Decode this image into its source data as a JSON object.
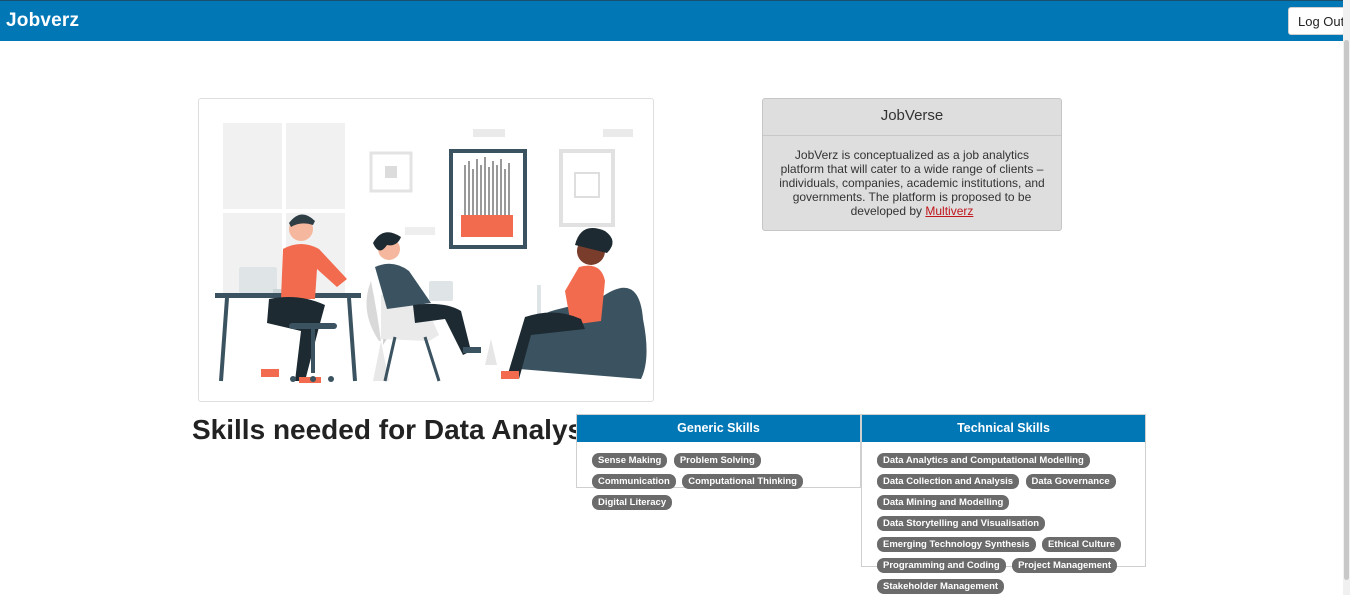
{
  "navbar": {
    "brand": "Jobverz",
    "logout_label": "Log Out"
  },
  "info_card": {
    "title": "JobVerse",
    "body": "JobVerz is conceptualized as a job analytics platform that will cater to a wide range of clients – individuals, companies, academic institutions, and governments. The platform is proposed to be developed by",
    "link_text": "Multiverz"
  },
  "heading": "Skills needed for Data Analyst",
  "generic_skills": {
    "title": "Generic Skills",
    "skills": [
      "Sense Making",
      "Problem Solving",
      "Communication",
      "Computational Thinking",
      "Digital Literacy"
    ]
  },
  "technical_skills": {
    "title": "Technical Skills",
    "skills": [
      "Data Analytics and Computational Modelling",
      "Data Collection and Analysis",
      "Data Governance",
      "Data Mining and Modelling",
      "Data Storytelling and Visualisation",
      "Emerging Technology Synthesis",
      "Ethical Culture",
      "Programming and Coding",
      "Project Management",
      "Stakeholder Management"
    ]
  },
  "colors": {
    "primary": "#0277b6",
    "chip": "#6b6b6b",
    "accent_red": "#f26b4e",
    "link": "#c0161c"
  }
}
